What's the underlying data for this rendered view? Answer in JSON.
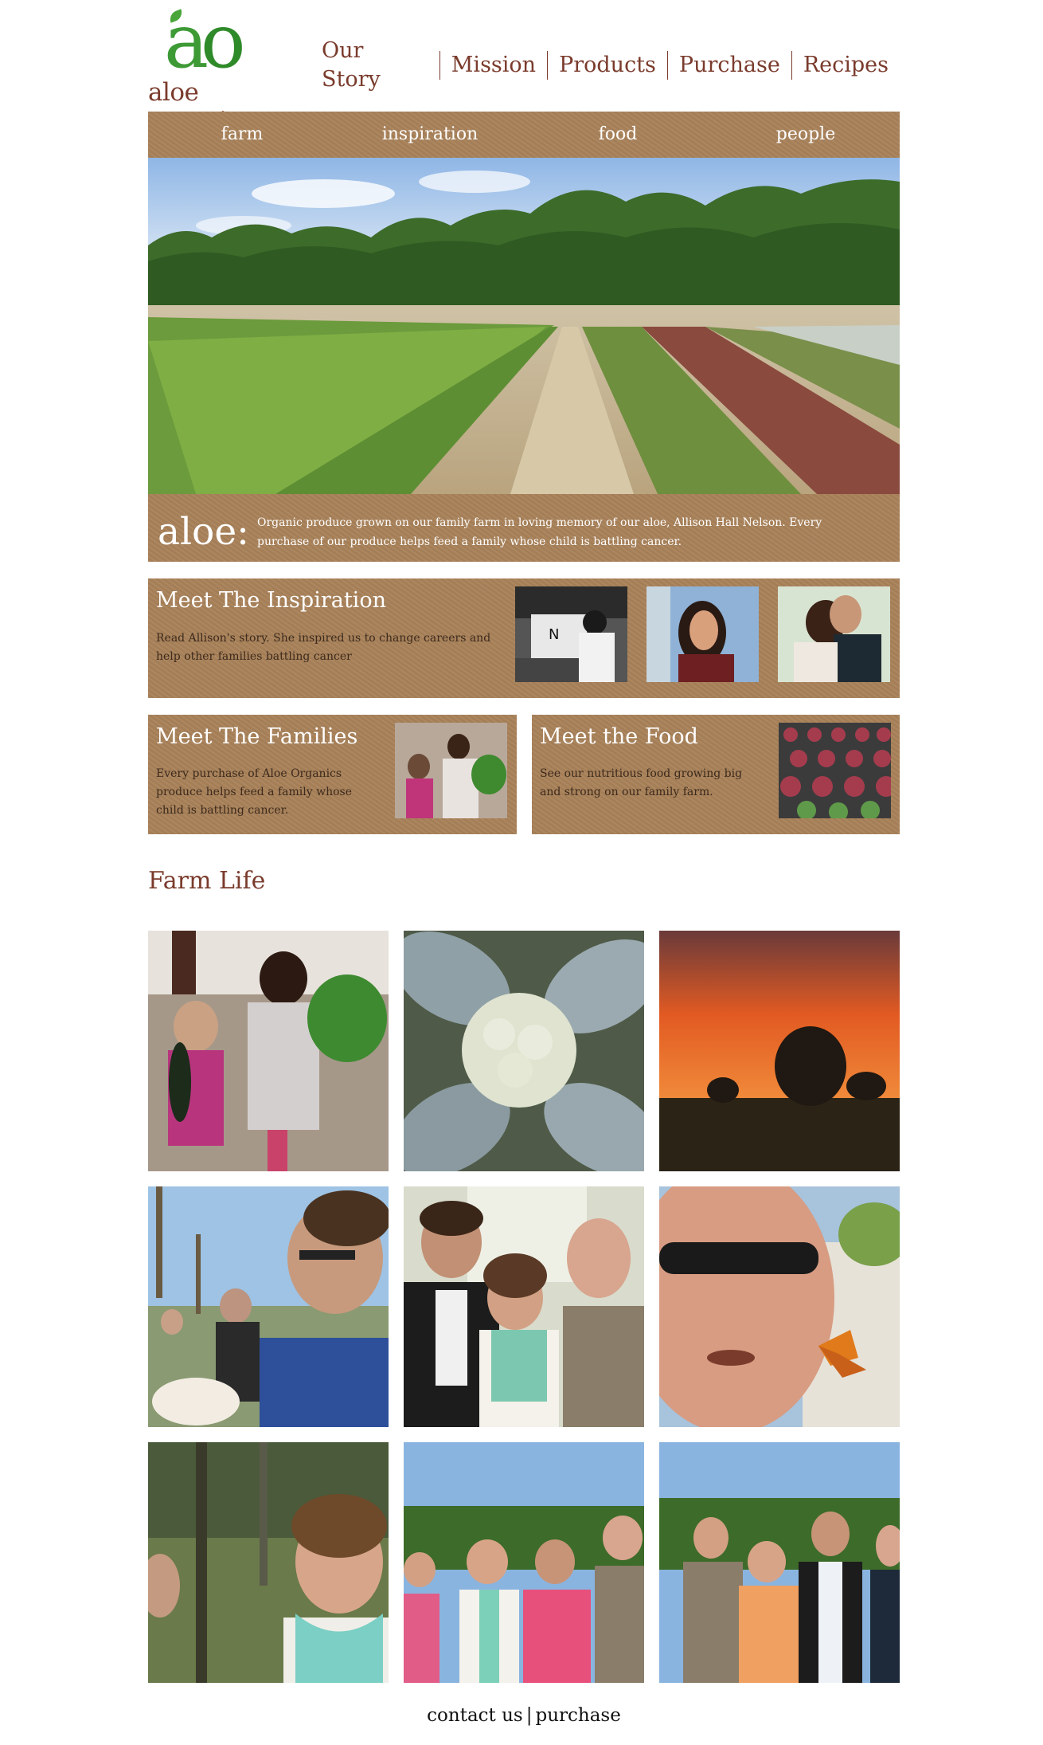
{
  "brand": {
    "monogram_a": "a",
    "monogram_o": "o",
    "wordmark": "aloe organics",
    "colors": {
      "green": "#3d9a35",
      "brown": "#7a3b2c",
      "kraft": "#a9825a"
    }
  },
  "top_nav": [
    "Our Story",
    "Mission",
    "Products",
    "Purchase",
    "Recipes"
  ],
  "sub_nav": [
    "farm",
    "inspiration",
    "food",
    "people"
  ],
  "hero": {
    "heading": "aloe:",
    "text": "Organic produce grown on our family farm in loving memory of our aloe, Allison Hall Nelson. Every purchase of our produce helps feed a family whose child is battling cancer."
  },
  "inspiration": {
    "title": "Meet The Inspiration",
    "text": "Read Allison's story. She inspired us to change careers and help other families battling cancer"
  },
  "families": {
    "title": "Meet The Families",
    "text": "Every purchase of Aloe Organics produce helps feed a family whose child is battling cancer."
  },
  "food": {
    "title": "Meet the Food",
    "text": "See our nutritious food growing big and strong on our family farm."
  },
  "farm_life": {
    "title": "Farm Life"
  },
  "footer": {
    "contact": "contact us",
    "separator": "|",
    "purchase": "purchase"
  }
}
